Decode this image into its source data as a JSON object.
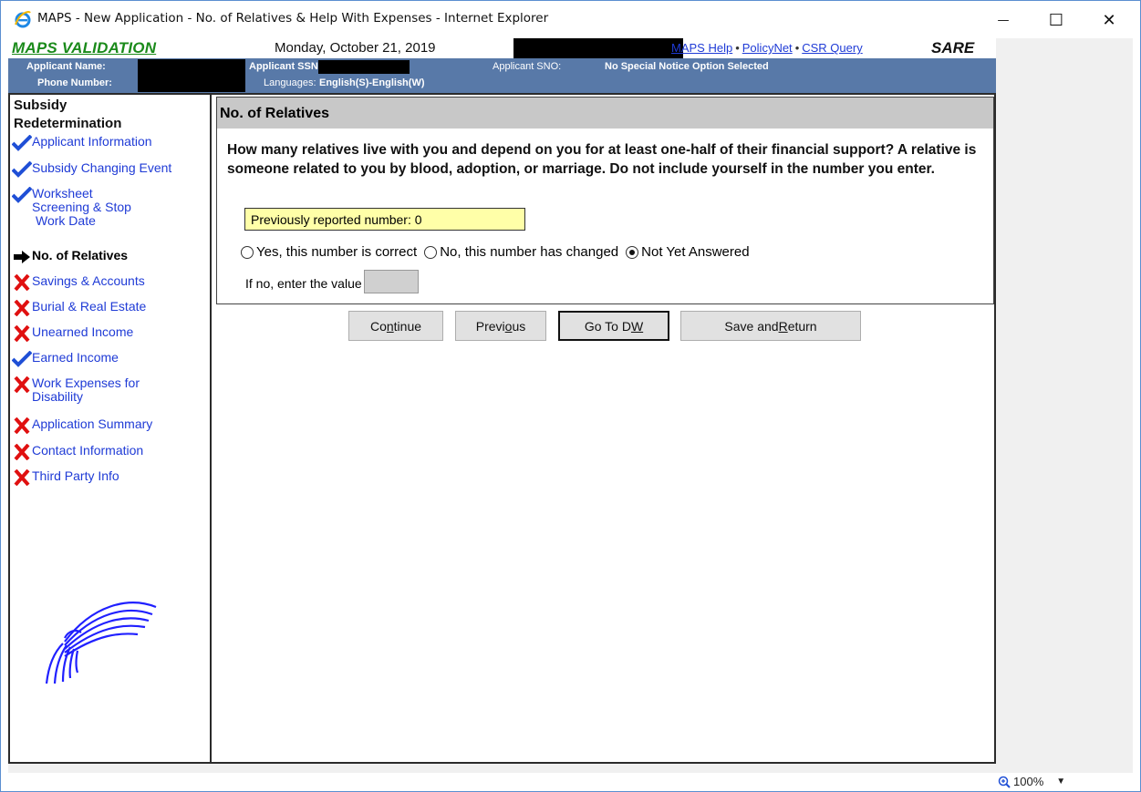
{
  "window": {
    "title": "MAPS - New Application - No. of Relatives & Help With Expenses - Internet Explorer",
    "minimize": "—",
    "maximize": "☐",
    "close": "✕"
  },
  "header": {
    "brand": "MAPS VALIDATION",
    "date": "Monday, October 21, 2019",
    "links": [
      "MAPS Help",
      "PolicyNet",
      "CSR Query"
    ],
    "separator": "•",
    "mode": "SARE"
  },
  "applicant": {
    "name_label": "Applicant Name:",
    "ssn_label": "Applicant SSN:",
    "sno_label": "Applicant SNO:",
    "sno_value": "No Special Notice Option Selected",
    "phone_label": "Phone Number:",
    "languages_label": "Languages:",
    "languages_value": "English(S)-English(W)"
  },
  "sidebar": {
    "title": "Subsidy Redetermination",
    "items": [
      {
        "label": "Applicant Information",
        "status": "check"
      },
      {
        "label": "Subsidy Changing Event",
        "status": "check"
      },
      {
        "label": "Worksheet Screening & Stop Work Date",
        "line1": "Worksheet",
        "line2": "Screening & Stop",
        "line3": "Work Date",
        "status": "check"
      },
      {
        "label": "No. of Relatives",
        "status": "current"
      },
      {
        "label": "Savings & Accounts",
        "status": "x"
      },
      {
        "label": "Burial & Real Estate",
        "status": "x"
      },
      {
        "label": "Unearned Income",
        "status": "x"
      },
      {
        "label": "Earned Income",
        "status": "check"
      },
      {
        "label": "Work Expenses for Disability",
        "line1": "Work Expenses for",
        "line2": "Disability",
        "status": "x"
      },
      {
        "label": "Application Summary",
        "status": "x"
      },
      {
        "label": "Contact Information",
        "status": "x"
      },
      {
        "label": "Third Party Info",
        "status": "x"
      }
    ]
  },
  "question": {
    "heading": "No. of Relatives",
    "text": "How many relatives live with you and depend on you for at least one-half of their financial support? A relative is someone related to you by blood, adoption, or marriage. Do not include yourself in the number you enter.",
    "previous": "Previously reported number:  0",
    "options": [
      {
        "label": "Yes, this number is correct",
        "selected": false
      },
      {
        "label": "No, this number has changed",
        "selected": false
      },
      {
        "label": "Not Yet Answered",
        "selected": true
      }
    ],
    "value_label": "If no, enter the value",
    "value": ""
  },
  "buttons": {
    "continue": {
      "pre": "Co",
      "key": "n",
      "post": "tinue"
    },
    "previous": {
      "pre": "Previ",
      "key": "o",
      "post": "us"
    },
    "goto_dw": {
      "pre": "Go To D",
      "key": "W",
      "post": ""
    },
    "save_return": {
      "pre": "Save and ",
      "key": "R",
      "post": "eturn"
    }
  },
  "status": {
    "zoom": "100%"
  },
  "colors": {
    "brand": "#1a8a1a",
    "info_bar": "#5879a8",
    "link": "#1f3bd6",
    "highlight": "#ffffa8",
    "x_mark": "#e01010",
    "check_mark": "#1f4fd6"
  }
}
